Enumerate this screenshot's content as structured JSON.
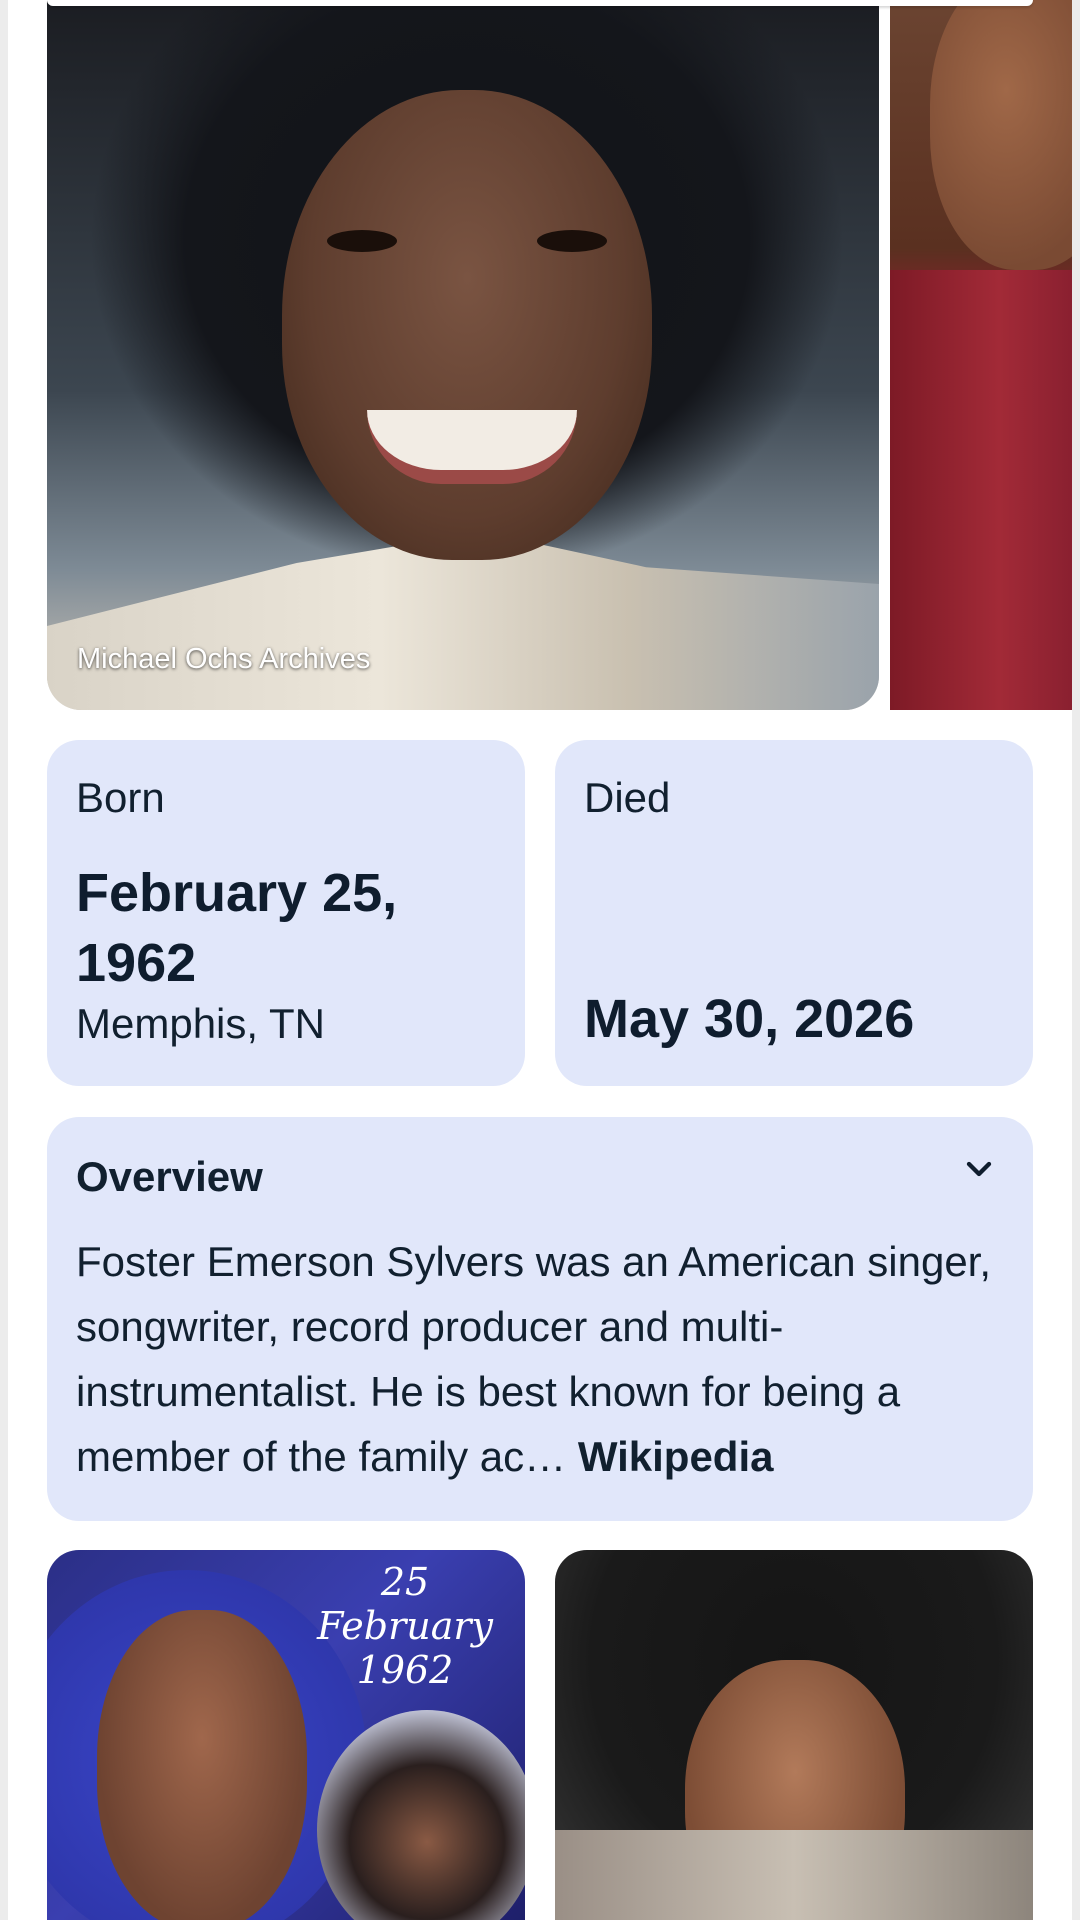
{
  "hero": {
    "caption": "Michael Ochs Archives"
  },
  "born": {
    "label": "Born",
    "date": "February 25, 1962",
    "place": "Memphis, TN"
  },
  "died": {
    "label": "Died",
    "date": "May 30, 2026"
  },
  "overview": {
    "title": "Overview",
    "text": "Foster Emerson Sylvers was an American singer, songwriter, record producer and multi-instrumentalist. He is best known for being a member of the family ac… ",
    "source": "Wikipedia",
    "toggle_icon": "chevron-down-icon"
  },
  "tiles": {
    "left_date": {
      "day": "25",
      "month": "February",
      "year": "1962"
    }
  },
  "colors": {
    "card_bg": "#e1e7fa",
    "text": "#0f1d2e"
  }
}
